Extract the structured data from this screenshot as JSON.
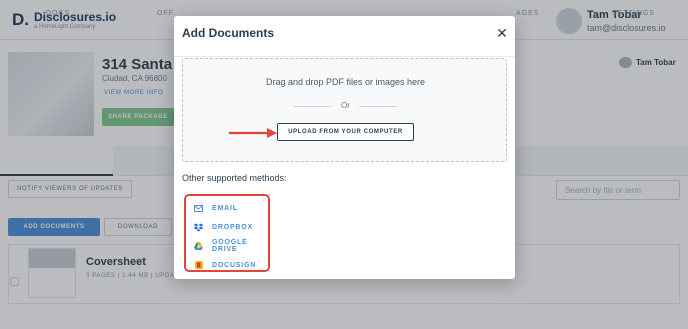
{
  "app": {
    "logo_mark": "D.",
    "logo_name": "Disclosures.io",
    "logo_sub": "a HomeLight Company",
    "user": {
      "name": "Tam Tobar",
      "email": "tam@disclosures.io"
    },
    "property": {
      "title": "314 Santa",
      "city": "Ciudad, CA 96800",
      "view_more": "VIEW MORE INFO",
      "share_button": "SHARE PACKAGE",
      "agent_name": "Tam Tobar"
    },
    "tabs": [
      {
        "label": "DOCS"
      },
      {
        "label": "OFF"
      },
      {
        "label": "AGES"
      },
      {
        "label": "SETTINGS"
      }
    ],
    "notify_button": "NOTIFY VIEWERS OF UPDATES",
    "search_placeholder": "Search by file or term",
    "add_documents_button": "ADD DOCUMENTS",
    "download_button": "DOWNLOAD",
    "document": {
      "title": "Coversheet",
      "meta": "3 PAGES | 1.44 MB | UPDA"
    }
  },
  "modal": {
    "title": "Add Documents",
    "close_glyph": "✕",
    "dropzone": {
      "instruction": "Drag and drop PDF files or images here",
      "or": "Or",
      "upload_button": "UPLOAD FROM YOUR COMPUTER"
    },
    "other_methods_label": "Other supported methods:",
    "methods": [
      {
        "label": "EMAIL",
        "icon": "mail-icon",
        "color": "#4a90d9"
      },
      {
        "label": "DROPBOX",
        "icon": "dropbox-icon",
        "color": "#2a6fdb"
      },
      {
        "label": "GOOGLE DRIVE",
        "icon": "google-drive-icon",
        "color": "#1fa463"
      },
      {
        "label": "DOCUSIGN",
        "icon": "docusign-icon",
        "color": "#f2b619"
      }
    ]
  },
  "colors": {
    "accent": "#4a90d9",
    "highlight_red": "#e2463a",
    "share_green": "#7ec98c",
    "text_dark": "#2c3e50"
  }
}
